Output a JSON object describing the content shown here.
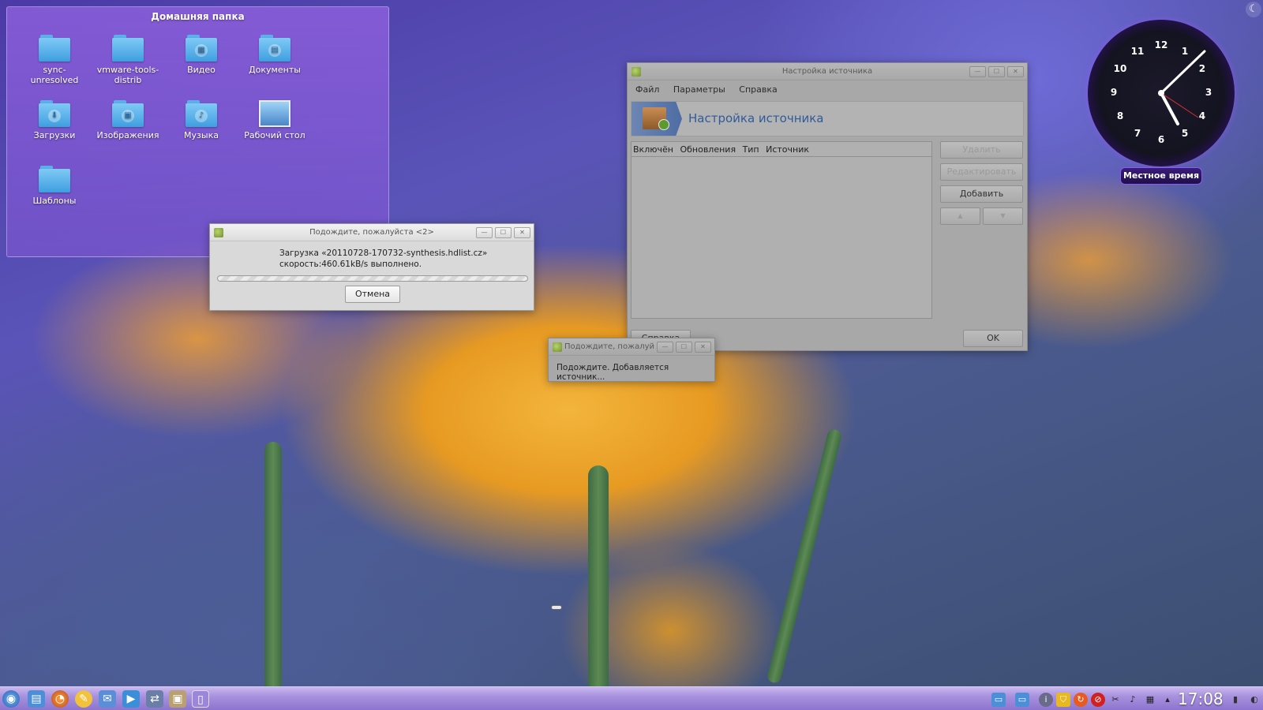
{
  "home_folder": {
    "title": "Домашняя папка",
    "items": [
      {
        "label": "sync-\nunresolved",
        "icon": "folder-icon"
      },
      {
        "label": "vmware-tools-\ndistrib",
        "icon": "folder-icon"
      },
      {
        "label": "Видео",
        "icon": "video-folder-icon"
      },
      {
        "label": "Документы",
        "icon": "documents-folder-icon"
      },
      {
        "label": "Загрузки",
        "icon": "downloads-folder-icon"
      },
      {
        "label": "Изображения",
        "icon": "pictures-folder-icon"
      },
      {
        "label": "Музыка",
        "icon": "music-folder-icon"
      },
      {
        "label": "Рабочий стол",
        "icon": "desktop-icon"
      },
      {
        "label": "Шаблоны",
        "icon": "templates-folder-icon"
      }
    ]
  },
  "wait_dialog_1": {
    "title": "Подождите, пожалуйста <2>",
    "line1": "Загрузка «20110728-170732-synthesis.hdlist.cz»",
    "line2": "скорость:460.61kB/s выполнено.",
    "cancel_label": "Отмена"
  },
  "source_config": {
    "title": "Настройка источника",
    "menu": [
      "Файл",
      "Параметры",
      "Справка"
    ],
    "header_title": "Настройка источника",
    "columns": [
      "Включён",
      "Обновления",
      "Тип",
      "Источник"
    ],
    "buttons": {
      "remove": "Удалить",
      "edit": "Редактировать",
      "add": "Добавить",
      "up": "▲",
      "down": "▼",
      "help": "Справка",
      "ok": "OK"
    }
  },
  "wait_dialog_2": {
    "title": "Подождите, пожалуйста",
    "message": "Подождите. Добавляется источник..."
  },
  "clock": {
    "numbers": [
      "12",
      "1",
      "2",
      "3",
      "4",
      "5",
      "6",
      "7",
      "8",
      "9",
      "10",
      "11"
    ],
    "label": "Местное время"
  },
  "taskbar": {
    "time": "17:08"
  },
  "colors": {
    "accent": "#8a5df0",
    "header_title": "#2f5b9a"
  }
}
